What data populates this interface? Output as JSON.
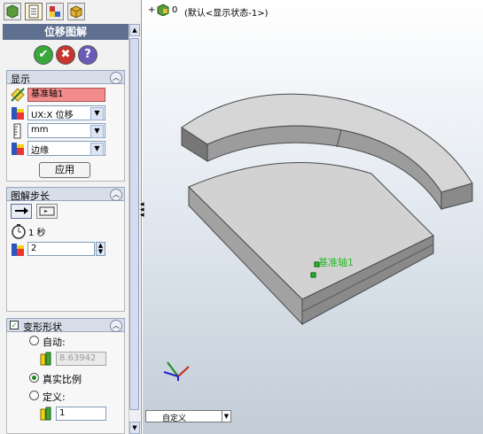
{
  "panel": {
    "title": "位移图解",
    "tabs": [
      "feature-manager-icon",
      "property-manager-icon",
      "configuration-manager-icon",
      "display-manager-icon"
    ],
    "actions": {
      "ok": "✔",
      "cancel": "✖",
      "help": "?"
    }
  },
  "display": {
    "header": "显示",
    "reference_axis": "基准轴1",
    "component": "UX:X 位移",
    "units": "mm",
    "render_mode": "边缘",
    "apply_label": "应用"
  },
  "steps": {
    "header": "图解步长",
    "time_label": "1 秒",
    "step_value": "2"
  },
  "deform": {
    "header": "变形形状",
    "checked": true,
    "auto_label": "自动:",
    "auto_value": "8.63942",
    "true_scale_label": "真实比例",
    "define_label": "定义:",
    "define_value": "1",
    "selected": "true_scale"
  },
  "viewport": {
    "tree_root": "0",
    "tree_desc": "(默认<显示状态-1>)",
    "axis_label": "基准轴1",
    "bottom_combo": "自定义"
  },
  "colors": {
    "highlight_field": "#f28b8b",
    "accent_green": "#26b726",
    "title_bar": "#5f6f8f"
  }
}
